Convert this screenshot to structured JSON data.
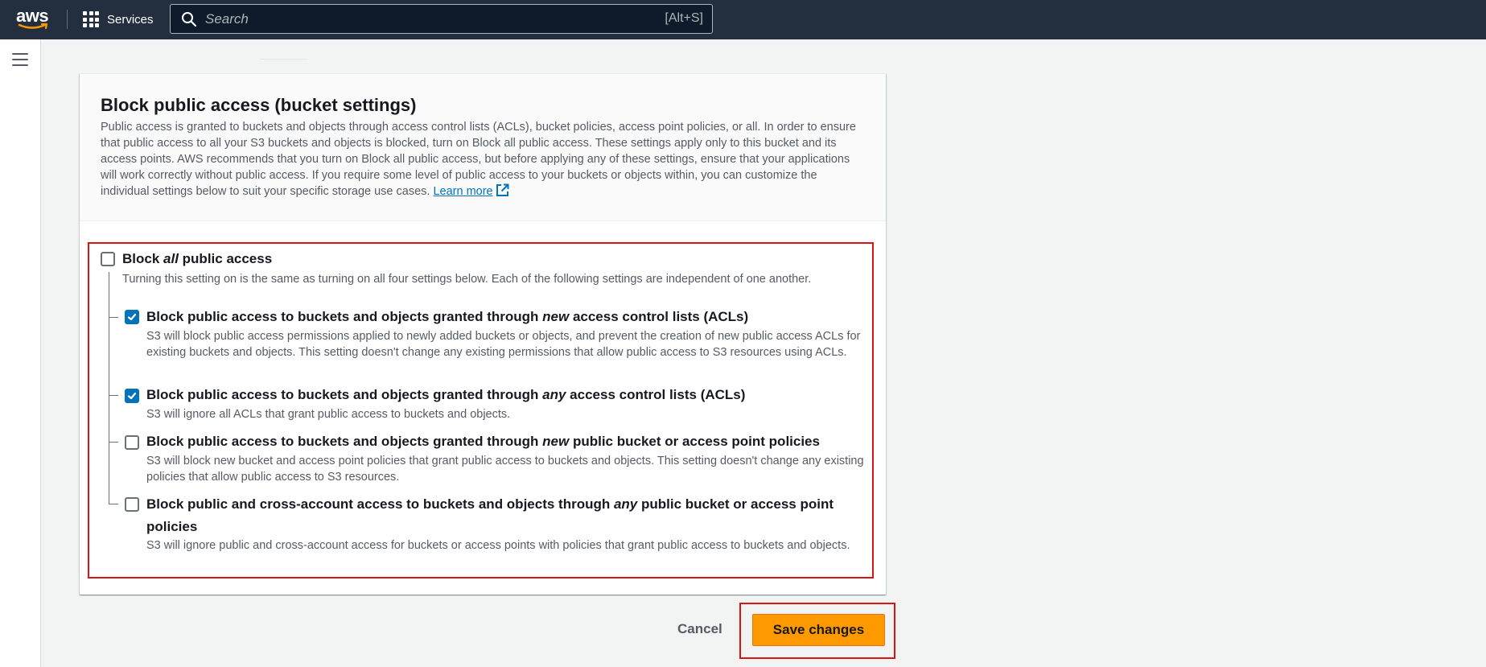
{
  "topnav": {
    "logo_text": "aws",
    "services_label": "Services",
    "search_placeholder": "Search",
    "search_shortcut": "[Alt+S]"
  },
  "card": {
    "title": "Block public access (bucket settings)",
    "description": "Public access is granted to buckets and objects through access control lists (ACLs), bucket policies, access point policies, or all. In order to ensure that public access to all your S3 buckets and objects is blocked, turn on Block all public access. These settings apply only to this bucket and its access points. AWS recommends that you turn on Block all public access, but before applying any of these settings, ensure that your applications will work correctly without public access. If you require some level of public access to your buckets or objects within, you can customize the individual settings below to suit your specific storage use cases.",
    "learn_more": "Learn more"
  },
  "block_all": {
    "title_pre": "Block ",
    "title_em": "all",
    "title_post": " public access",
    "description": "Turning this setting on is the same as turning on all four settings below. Each of the following settings are independent of one another.",
    "checked": false
  },
  "options": [
    {
      "title_pre": "Block public access to buckets and objects granted through ",
      "title_em": "new",
      "title_post": " access control lists (ACLs)",
      "description": "S3 will block public access permissions applied to newly added buckets or objects, and prevent the creation of new public access ACLs for existing buckets and objects. This setting doesn't change any existing permissions that allow public access to S3 resources using ACLs.",
      "checked": true
    },
    {
      "title_pre": "Block public access to buckets and objects granted through ",
      "title_em": "any",
      "title_post": " access control lists (ACLs)",
      "description": "S3 will ignore all ACLs that grant public access to buckets and objects.",
      "checked": true
    },
    {
      "title_pre": "Block public access to buckets and objects granted through ",
      "title_em": "new",
      "title_post": " public bucket or access point policies",
      "description": "S3 will block new bucket and access point policies that grant public access to buckets and objects. This setting doesn't change any existing policies that allow public access to S3 resources.",
      "checked": false
    },
    {
      "title_pre": "Block public and cross-account access to buckets and objects through ",
      "title_em": "any",
      "title_post": " public bucket or access point policies",
      "description": "S3 will ignore public and cross-account access for buckets or access points with policies that grant public access to buckets and objects.",
      "checked": false
    }
  ],
  "actions": {
    "cancel_label": "Cancel",
    "save_label": "Save changes"
  },
  "colors": {
    "nav_bg": "#232f3e",
    "primary_button": "#ff9900",
    "checkbox_checked": "#0073bb",
    "highlight_border": "#d91515",
    "link": "#0073bb"
  }
}
